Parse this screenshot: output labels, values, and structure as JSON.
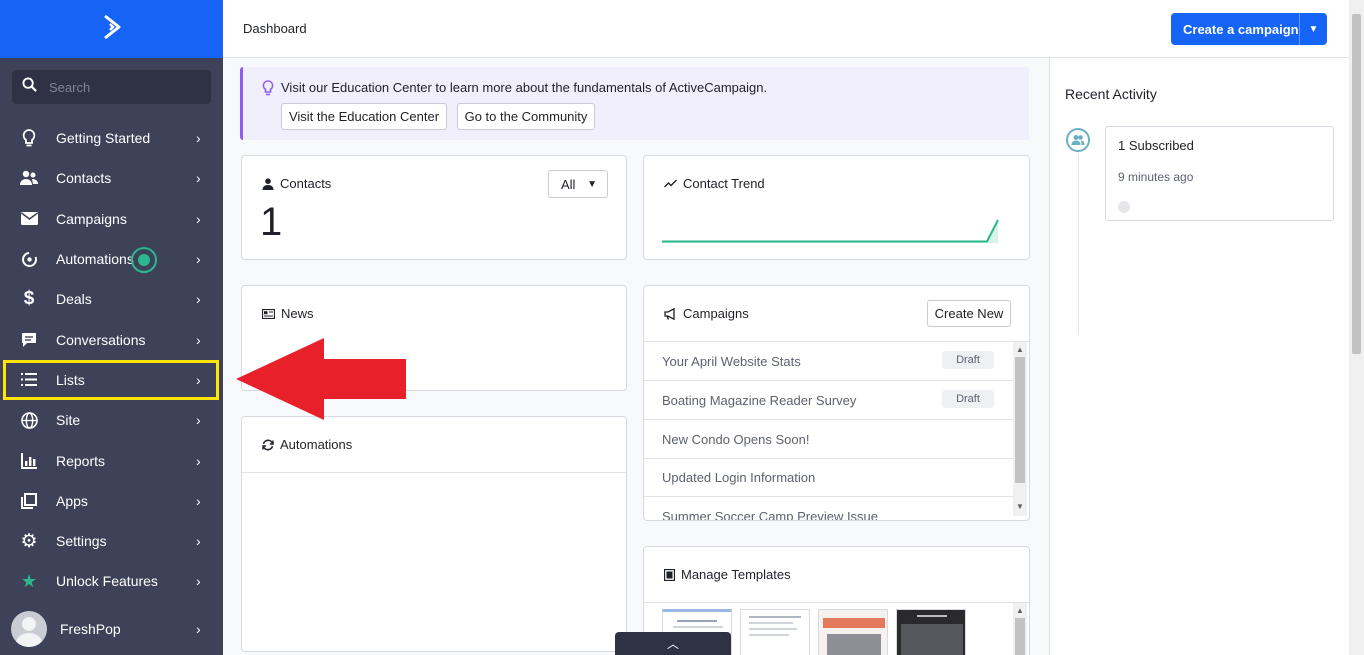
{
  "sidebar": {
    "search_placeholder": "Search",
    "items": [
      {
        "label": "Getting Started",
        "icon": "lightbulb-icon"
      },
      {
        "label": "Contacts",
        "icon": "contacts-icon"
      },
      {
        "label": "Campaigns",
        "icon": "envelope-icon"
      },
      {
        "label": "Automations",
        "icon": "automations-icon"
      },
      {
        "label": "Deals",
        "icon": "dollar-icon"
      },
      {
        "label": "Conversations",
        "icon": "chat-icon"
      },
      {
        "label": "Lists",
        "icon": "list-icon"
      },
      {
        "label": "Site",
        "icon": "globe-icon"
      },
      {
        "label": "Reports",
        "icon": "bar-chart-icon"
      },
      {
        "label": "Apps",
        "icon": "apps-icon"
      },
      {
        "label": "Settings",
        "icon": "gear-icon"
      },
      {
        "label": "Unlock Features",
        "icon": "star-icon"
      }
    ],
    "user": {
      "name": "FreshPop"
    }
  },
  "topbar": {
    "title": "Dashboard",
    "cta_label": "Create a campaign"
  },
  "banner": {
    "message": "Visit our Education Center to learn more about the fundamentals of ActiveCampaign.",
    "btn_education": "Visit the Education Center",
    "btn_community": "Go to the Community"
  },
  "contacts_card": {
    "title": "Contacts",
    "count": "1",
    "filter": "All"
  },
  "trend_card": {
    "title": "Contact Trend"
  },
  "news_card": {
    "title": "News"
  },
  "automations_card": {
    "title": "Automations"
  },
  "campaigns_card": {
    "title": "Campaigns",
    "create_label": "Create New",
    "rows": [
      {
        "name": "Your April Website Stats",
        "status": "Draft"
      },
      {
        "name": "Boating Magazine Reader Survey",
        "status": "Draft"
      },
      {
        "name": "New Condo Opens Soon!",
        "status": ""
      },
      {
        "name": "Updated Login Information",
        "status": ""
      },
      {
        "name": "Summer Soccer Camp Preview Issue",
        "status": ""
      }
    ]
  },
  "templates_card": {
    "title": "Manage Templates"
  },
  "activity": {
    "heading": "Recent Activity",
    "item_title": "1 Subscribed",
    "item_time": "9 minutes ago"
  },
  "colors": {
    "brand_blue": "#1664f5",
    "sidebar": "#3e4259",
    "accent_green": "#2bb88d",
    "highlight_yellow": "#ffe600",
    "arrow_red": "#e8202a"
  }
}
